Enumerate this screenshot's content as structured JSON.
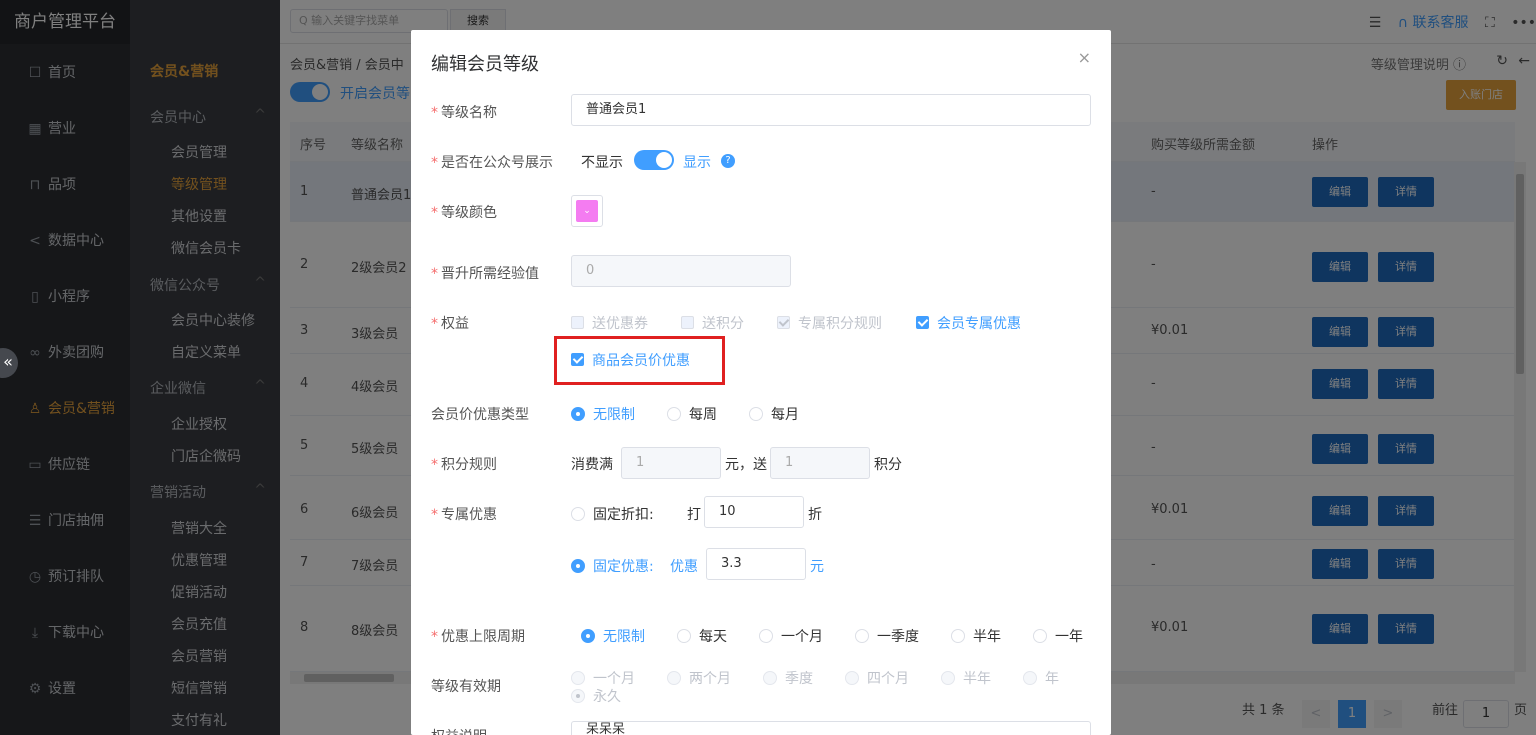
{
  "app": {
    "title": "商户管理平台"
  },
  "sidebar": {
    "items": [
      {
        "label": "首页",
        "icon": "home-icon",
        "glyph": "☐"
      },
      {
        "label": "营业",
        "icon": "calendar-icon",
        "glyph": "▦"
      },
      {
        "label": "品项",
        "icon": "bag-icon",
        "glyph": "⊓"
      },
      {
        "label": "数据中心",
        "icon": "share-icon",
        "glyph": "<"
      },
      {
        "label": "小程序",
        "icon": "mobile-icon",
        "glyph": "▯"
      },
      {
        "label": "外卖团购",
        "icon": "bike-icon",
        "glyph": "∞"
      },
      {
        "label": "会员&营销",
        "icon": "user-icon",
        "glyph": "♙"
      },
      {
        "label": "供应链",
        "icon": "truck-icon",
        "glyph": "▭"
      },
      {
        "label": "门店抽佣",
        "icon": "database-icon",
        "glyph": "☰"
      },
      {
        "label": "预订排队",
        "icon": "clock-icon",
        "glyph": "◷"
      },
      {
        "label": "下载中心",
        "icon": "download-icon",
        "glyph": "⤓"
      },
      {
        "label": "设置",
        "icon": "gear-icon",
        "glyph": "⚙"
      }
    ],
    "collapse_glyph": "«"
  },
  "subnav": {
    "head": "会员&营销",
    "groups": [
      {
        "label": "会员中心"
      },
      {
        "label": "微信公众号"
      },
      {
        "label": "企业微信"
      },
      {
        "label": "营销活动"
      }
    ],
    "items": [
      "会员管理",
      "等级管理",
      "其他设置",
      "微信会员卡",
      "会员中心装修",
      "自定义菜单",
      "企业授权",
      "门店企微码",
      "营销大全",
      "优惠管理",
      "促销活动",
      "会员充值",
      "会员营销",
      "短信营销",
      "支付有礼"
    ],
    "chevron": "^"
  },
  "topbar": {
    "search_placeholder": "Q 输入关键字找菜单",
    "search_button": "搜索",
    "message_glyph": "☰",
    "service": "∩ 联系客服",
    "fullscreen_glyph": "⛶",
    "more_glyph": "•••"
  },
  "main": {
    "breadcrumb": "会员&营销 / 会员中",
    "switch_label": "开启会员等",
    "help": "等级管理说明 ⓘ",
    "refresh_glyph": "↻",
    "back_glyph": "←",
    "store_button": "入账门店",
    "columns": [
      "序号",
      "等级名称",
      "购买等级所需金额",
      "操作"
    ],
    "rows": [
      {
        "no": "1",
        "name": "普通会员1",
        "price": "-"
      },
      {
        "no": "2",
        "name": "2级会员2",
        "price": "-"
      },
      {
        "no": "3",
        "name": "3级会员",
        "price": "¥0.01"
      },
      {
        "no": "4",
        "name": "4级会员",
        "price": "-"
      },
      {
        "no": "5",
        "name": "5级会员",
        "price": "-"
      },
      {
        "no": "6",
        "name": "6级会员",
        "price": "¥0.01"
      },
      {
        "no": "7",
        "name": "7级会员",
        "price": "-"
      },
      {
        "no": "8",
        "name": "8级会员",
        "price": "¥0.01"
      }
    ],
    "edit_label": "编辑",
    "detail_label": "详情",
    "pager": {
      "total": "共 1 条",
      "prev": "<",
      "current": "1",
      "next": ">",
      "goto": "前往",
      "goto_value": "1",
      "page_unit": "页"
    }
  },
  "modal": {
    "title": "编辑会员等级",
    "close_glyph": "×",
    "required_mark": "*",
    "level_name": {
      "label": "等级名称",
      "value": "普通会员1"
    },
    "show_in_official": {
      "label": "是否在公众号展示",
      "off": "不显示",
      "on": "显示",
      "help": "?"
    },
    "level_color": {
      "label": "等级颜色",
      "value": "#f47cf1",
      "chevron": "⌄"
    },
    "upgrade_exp": {
      "label": "晋升所需经验值",
      "value": "0"
    },
    "benefits": {
      "label": "权益",
      "options": [
        {
          "label": "送优惠券",
          "checked": false,
          "disabled": true
        },
        {
          "label": "送积分",
          "checked": false,
          "disabled": true
        },
        {
          "label": "专属积分规则",
          "checked": true,
          "disabled": true
        },
        {
          "label": "会员专属优惠",
          "checked": true,
          "disabled": false
        },
        {
          "label": "商品会员价优惠",
          "checked": true,
          "disabled": false
        }
      ]
    },
    "member_price_type": {
      "label": "会员价优惠类型",
      "options": [
        "无限制",
        "每周",
        "每月"
      ],
      "selected": "无限制"
    },
    "points_rule": {
      "label": "积分规则",
      "prefix": "消费满",
      "amount": "1",
      "mid": "元，送",
      "points": "1",
      "suffix": "积分"
    },
    "exclusive": {
      "label": "专属优惠",
      "discount": {
        "label": "固定折扣:",
        "prefix": "打",
        "value": "10",
        "suffix": "折"
      },
      "fixed": {
        "label": "固定优惠:",
        "prefix": "优惠",
        "value": "3.3",
        "suffix": "元"
      }
    },
    "limit_period": {
      "label": "优惠上限周期",
      "options": [
        "无限制",
        "每天",
        "一个月",
        "一季度",
        "半年",
        "一年"
      ],
      "selected": "无限制"
    },
    "validity": {
      "label": "等级有效期",
      "options": [
        "一个月",
        "两个月",
        "季度",
        "四个月",
        "半年",
        "年",
        "永久"
      ],
      "selected": "永久"
    },
    "benefit_desc": {
      "label": "权益说明",
      "value": "呆呆呆"
    }
  },
  "highlight_color": "#e02020",
  "accent_color": "#409eff"
}
